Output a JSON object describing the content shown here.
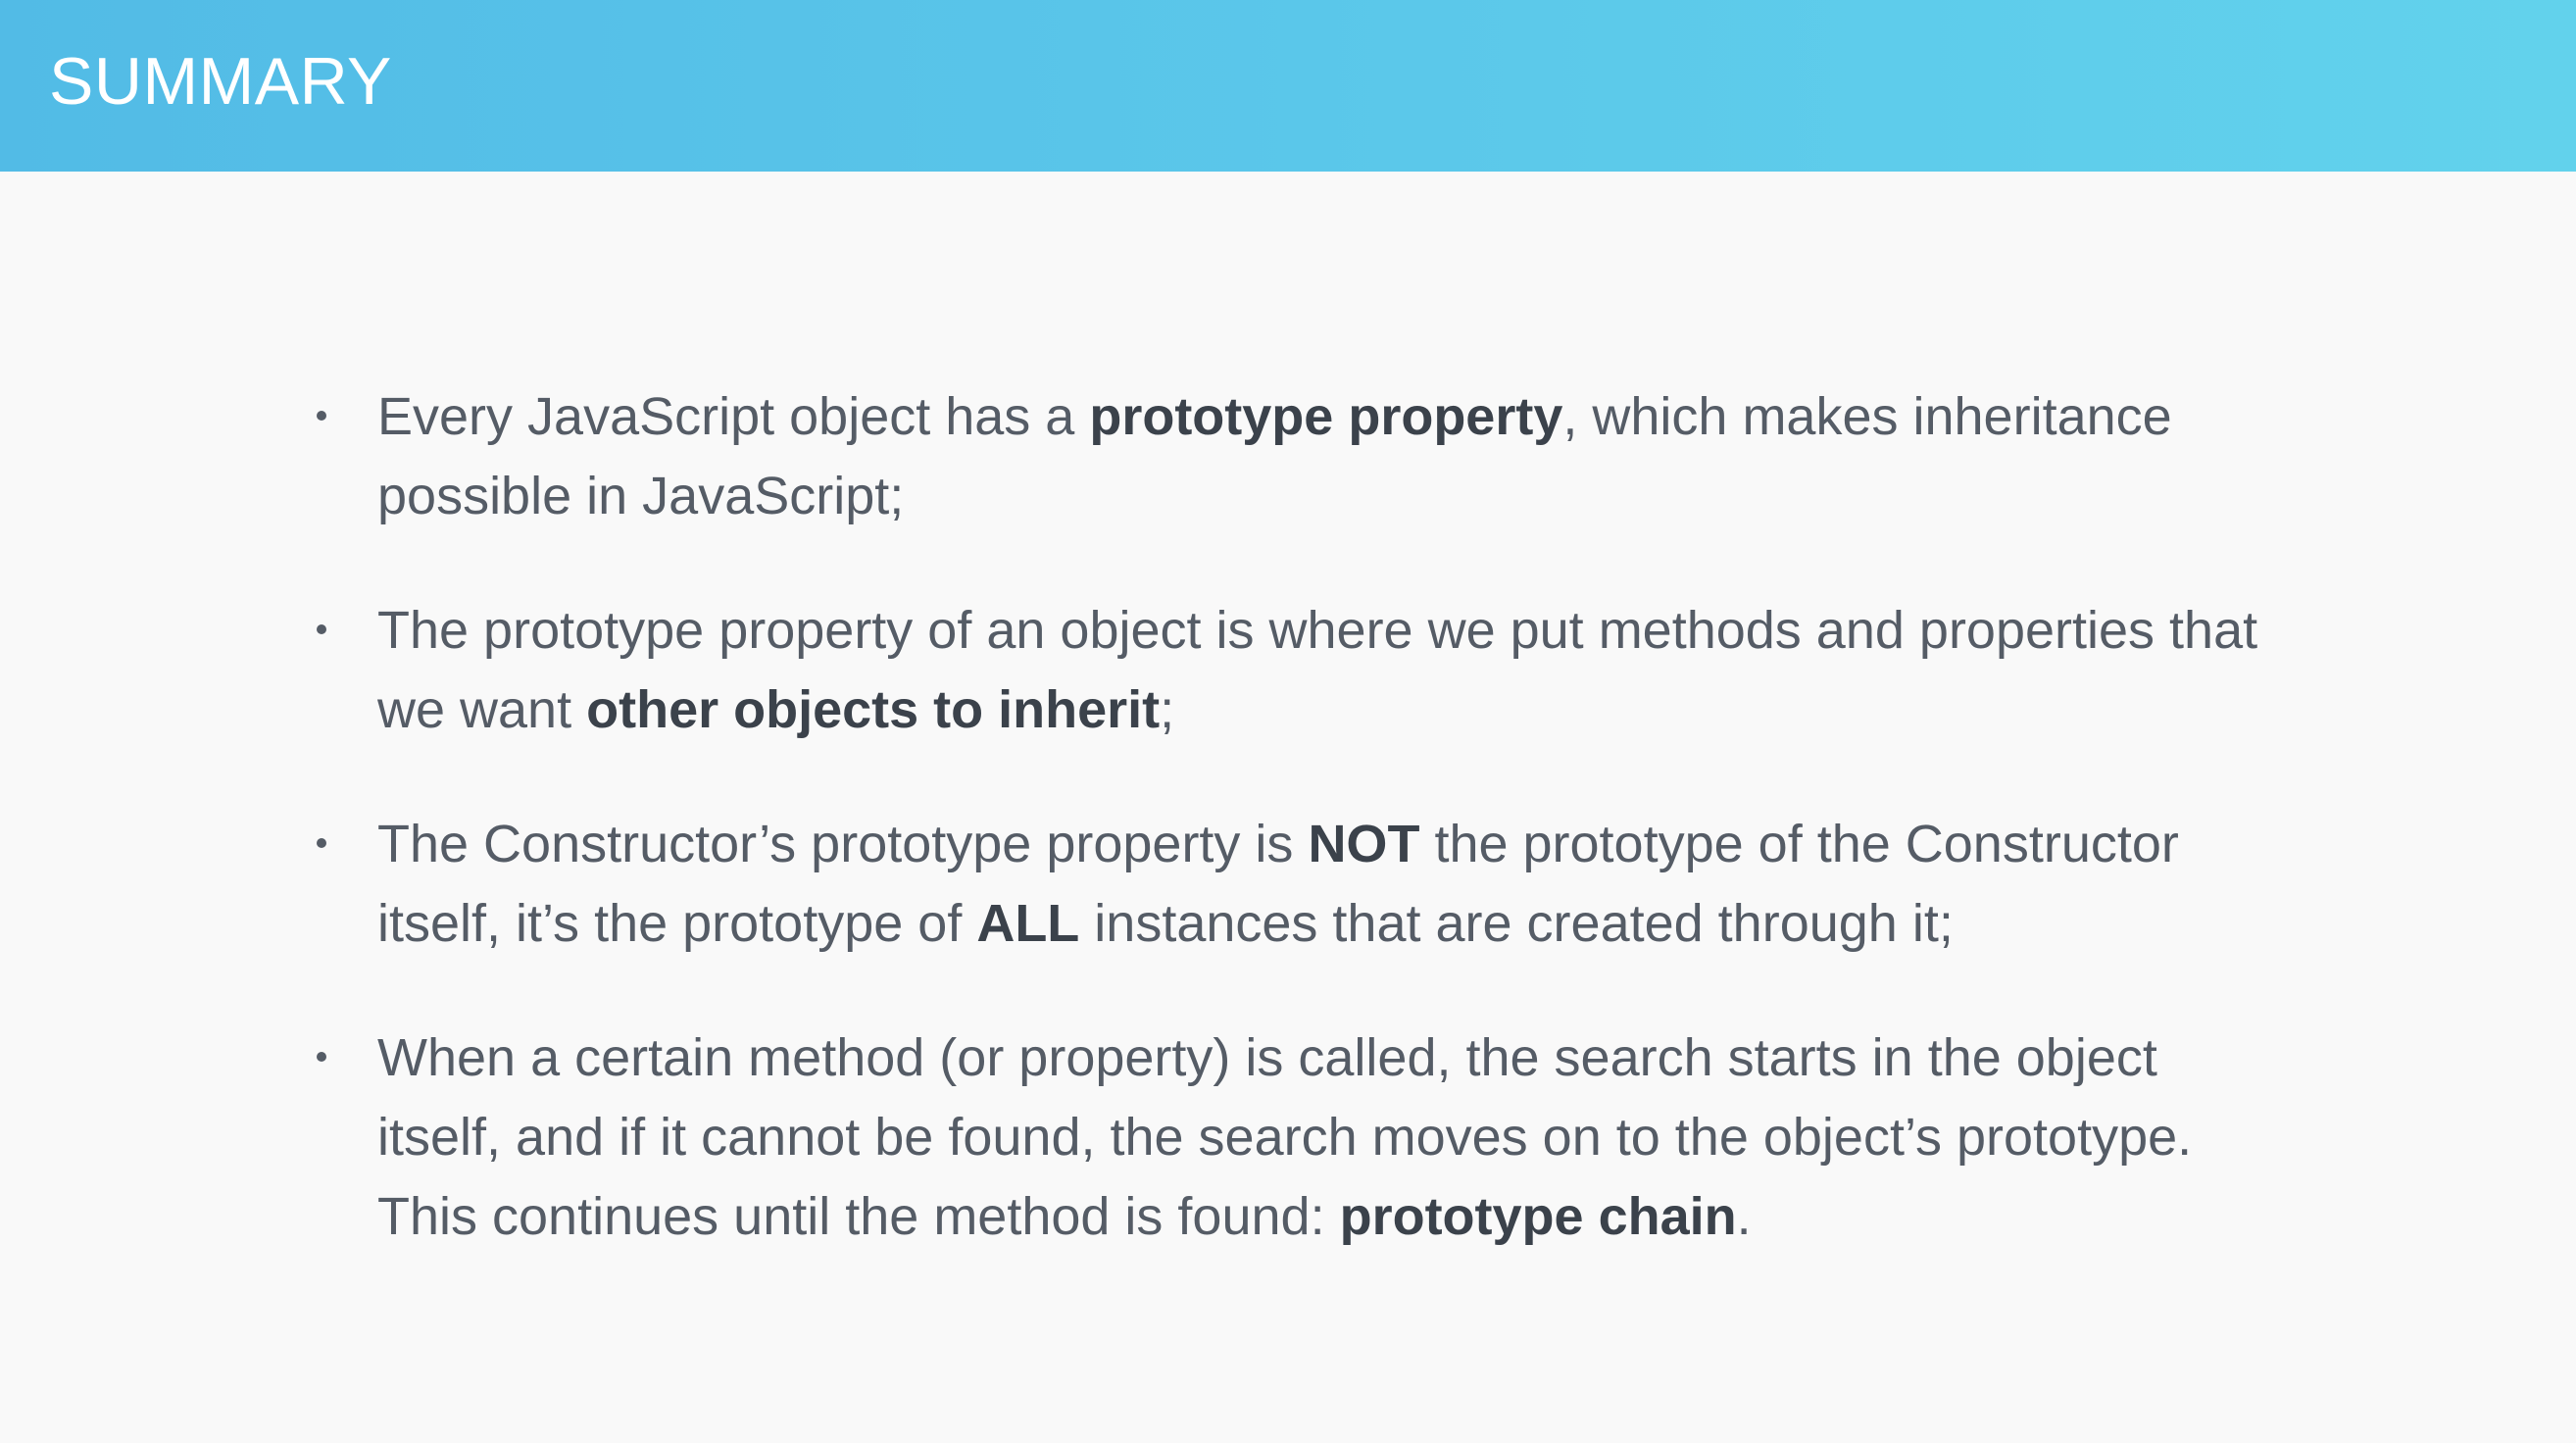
{
  "slide": {
    "title": "SUMMARY"
  },
  "bullets": [
    {
      "before": "Every JavaScript object has a ",
      "emphasis": "prototype property",
      "after": ", which makes inheritance possible in JavaScript;"
    },
    {
      "before": "The prototype property of an object is where we put methods and properties that we want ",
      "emphasis": "other objects to inherit",
      "after": ";"
    },
    {
      "before": "The Constructor’s prototype property is ",
      "emphasis": "NOT",
      "middle": " the prototype of the Constructor itself, it’s the prototype of ",
      "emphasis2": "ALL",
      "after": " instances that are created through it;"
    },
    {
      "before": "When a certain method (or property) is called, the search starts in the object itself, and if it cannot be found, the search moves on to the object’s prototype. This continues until the method is found: ",
      "emphasis": "prototype chain",
      "after": "."
    }
  ],
  "colors": {
    "header_start": "#52bbe6",
    "header_end": "#62d2ec",
    "background": "#f9f9f9",
    "body_text": "#555c66",
    "emphasis_text": "#3b424b"
  }
}
